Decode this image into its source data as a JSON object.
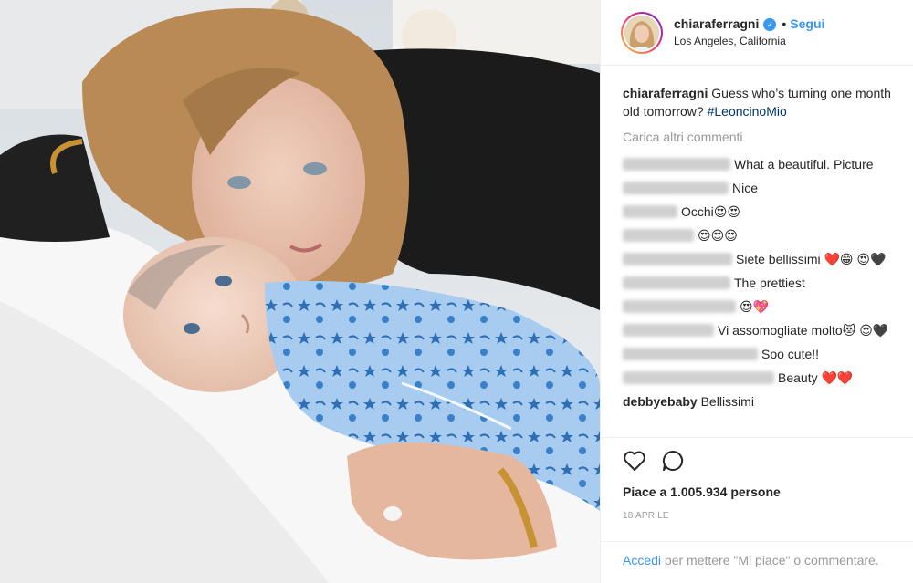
{
  "post": {
    "username": "chiaraferragni",
    "follow_label": "Segui",
    "location": "Los Angeles, California",
    "bullet": "•",
    "verified_mark": "✓",
    "caption_user": "chiaraferragni",
    "caption_text": "Guess who’s turning one month old tomorrow?",
    "caption_hashtag": "#LeoncinoMio",
    "load_more": "Carica altri commenti",
    "likes_label": "Piace a 1.005.934 persone",
    "date": "18 APRILE",
    "footer_login": "Accedi",
    "footer_rest": "per mettere \"Mi piace\" o commentare."
  },
  "comments": [
    {
      "text": "What a beautiful. Picture",
      "emoji": ""
    },
    {
      "text": "Nice",
      "emoji": ""
    },
    {
      "text": "Occhi",
      "emoji": "😍😍"
    },
    {
      "text": "",
      "emoji": "😍😍😍"
    },
    {
      "text": "Siete bellissimi",
      "emoji": "❤️😁 😍🖤"
    },
    {
      "text": "The prettiest",
      "emoji": ""
    },
    {
      "text": "",
      "emoji": "😍💖"
    },
    {
      "text": "Vi assomogliate molto",
      "emoji": "😻 😍🖤"
    },
    {
      "text": "Soo cute!!",
      "emoji": ""
    },
    {
      "text": "Beauty",
      "emoji": "❤️❤️"
    }
  ],
  "last_comment": {
    "user": "debbyebaby",
    "text": "Bellissimi"
  },
  "colors": {
    "accent": "#3897f0",
    "hashtag": "#003569",
    "muted": "#999999"
  },
  "icons": {
    "like": "heart-icon",
    "comment": "comment-icon",
    "verified": "verified-badge-icon"
  }
}
